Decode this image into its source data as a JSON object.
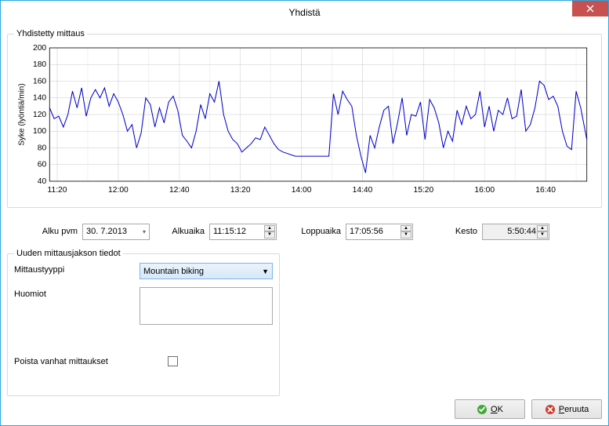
{
  "window": {
    "title": "Yhdistä"
  },
  "chart_group": {
    "legend": "Yhdistetty mittaus"
  },
  "chart_data": {
    "type": "line",
    "title": "",
    "xlabel": "",
    "ylabel": "Syke (lyöntiä/min)",
    "ylim": [
      40,
      200
    ],
    "yticks": [
      40,
      60,
      80,
      100,
      120,
      140,
      160,
      180,
      200
    ],
    "xticks": [
      "11:20",
      "12:00",
      "12:40",
      "13:20",
      "14:00",
      "14:40",
      "15:20",
      "16:00",
      "16:40"
    ],
    "xrange_minutes": [
      675,
      1027
    ],
    "series": [
      {
        "name": "Syke",
        "color": "#0000cc",
        "x": [
          675,
          678,
          681,
          684,
          687,
          690,
          693,
          696,
          699,
          702,
          705,
          708,
          711,
          714,
          717,
          720,
          723,
          726,
          729,
          732,
          735,
          738,
          741,
          744,
          747,
          750,
          753,
          756,
          759,
          762,
          765,
          768,
          771,
          774,
          777,
          780,
          783,
          786,
          789,
          792,
          795,
          798,
          801,
          804,
          807,
          810,
          813,
          816,
          819,
          822,
          825,
          828,
          836,
          858,
          861,
          864,
          867,
          870,
          873,
          876,
          879,
          882,
          885,
          888,
          891,
          894,
          897,
          900,
          903,
          906,
          909,
          912,
          915,
          918,
          921,
          924,
          927,
          930,
          933,
          936,
          939,
          942,
          945,
          948,
          951,
          954,
          957,
          960,
          963,
          966,
          969,
          972,
          975,
          978,
          981,
          984,
          987,
          990,
          993,
          996,
          999,
          1002,
          1005,
          1008,
          1011,
          1014,
          1017,
          1020,
          1023,
          1027
        ],
        "y": [
          128,
          115,
          118,
          105,
          120,
          148,
          128,
          152,
          118,
          140,
          150,
          140,
          152,
          130,
          145,
          135,
          120,
          100,
          108,
          80,
          98,
          140,
          132,
          105,
          128,
          110,
          135,
          142,
          125,
          95,
          88,
          80,
          100,
          132,
          115,
          145,
          135,
          160,
          120,
          100,
          90,
          85,
          75,
          80,
          85,
          92,
          90,
          105,
          95,
          85,
          78,
          75,
          70,
          70,
          145,
          120,
          148,
          138,
          130,
          95,
          70,
          50,
          95,
          80,
          105,
          125,
          130,
          85,
          110,
          140,
          95,
          120,
          118,
          135,
          90,
          138,
          128,
          110,
          80,
          100,
          88,
          125,
          108,
          130,
          115,
          120,
          148,
          105,
          130,
          100,
          125,
          120,
          140,
          115,
          118,
          150,
          100,
          108,
          128,
          160,
          155,
          138,
          142,
          130,
          100,
          82,
          78,
          148,
          128,
          90
        ]
      }
    ]
  },
  "times": {
    "alku_pvm_label": "Alku pvm",
    "alku_pvm_value": "30.  7.2013",
    "alkuaika_label": "Alkuaika",
    "alkuaika_value": "11:15:12",
    "loppuaika_label": "Loppuaika",
    "loppuaika_value": "17:05:56",
    "kesto_label": "Kesto",
    "kesto_value": "5:50:44"
  },
  "details": {
    "legend": "Uuden mittausjakson tiedot",
    "type_label": "Mittaustyyppi",
    "type_value": "Mountain biking",
    "notes_label": "Huomiot",
    "notes_value": "",
    "delete_label": "Poista vanhat mittaukset",
    "delete_checked": false
  },
  "buttons": {
    "ok_prefix": "O",
    "ok_rest": "K",
    "cancel_prefix": "P",
    "cancel_rest": "eruuta"
  }
}
